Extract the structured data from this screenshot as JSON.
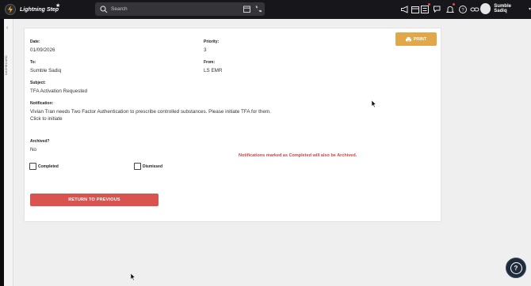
{
  "header": {
    "app_name": "Lightning Step",
    "search_placeholder": "Search",
    "user_name": "Sumble Sadiq",
    "icons": [
      "megaphone-icon",
      "calendar-icon",
      "list-icon",
      "chat-icon",
      "bell-icon",
      "help-icon",
      "link-icon"
    ]
  },
  "sidebar": {
    "label": "DASHBOARD"
  },
  "notification": {
    "date_label": "Date:",
    "date": "01/09/2026",
    "priority_label": "Priority:",
    "priority": "3",
    "to_label": "To:",
    "to": "Sumble Sadiq",
    "from_label": "From:",
    "from": "LS EMR",
    "subject_label": "Subject:",
    "subject": "TFA Activation Requested",
    "notification_label": "Notification:",
    "notification_text": "Vivian Tran needs Two Factor Authentication to prescribe controlled substances. Please initiate TFA for them.",
    "click_text": "Click to initiate",
    "archived_label": "Archived?",
    "archived": "No",
    "completed_label": "Completed",
    "dismissed_label": "Dismissed",
    "archive_note": "Notifications marked as Completed will also be Archived.",
    "print_label": "PRINT",
    "return_label": "RETURN TO PREVIOUS"
  },
  "colors": {
    "topbar": "#17171b",
    "print_button": "#e1a748",
    "return_button": "#d9534f",
    "warning_text": "#d64040",
    "notification_dot": "#e24a4a"
  }
}
